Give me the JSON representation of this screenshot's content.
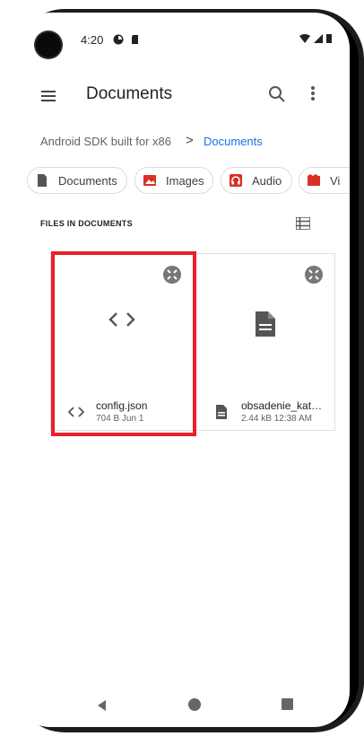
{
  "status_bar": {
    "time": "4:20"
  },
  "toolbar": {
    "title": "Documents"
  },
  "breadcrumb": {
    "root": "Android SDK built for x86",
    "separator": ">",
    "current": "Documents"
  },
  "chips": [
    {
      "label": "Documents",
      "icon": "document-icon"
    },
    {
      "label": "Images",
      "icon": "image-icon"
    },
    {
      "label": "Audio",
      "icon": "audio-icon"
    },
    {
      "label": "Vi",
      "icon": "video-icon"
    }
  ],
  "section": {
    "title": "FILES IN DOCUMENTS"
  },
  "files": [
    {
      "name": "config.json",
      "meta": "704 B Jun 1",
      "type_icon": "code-icon"
    },
    {
      "name": "obsadenie_kat…",
      "meta": "2.44 kB 12:38 AM",
      "type_icon": "document-icon"
    }
  ],
  "colors": {
    "accent": "#1a73e8",
    "highlight": "#e8202a",
    "image_chip": "#d93025",
    "audio_chip": "#d93025",
    "video_chip": "#d93025"
  }
}
